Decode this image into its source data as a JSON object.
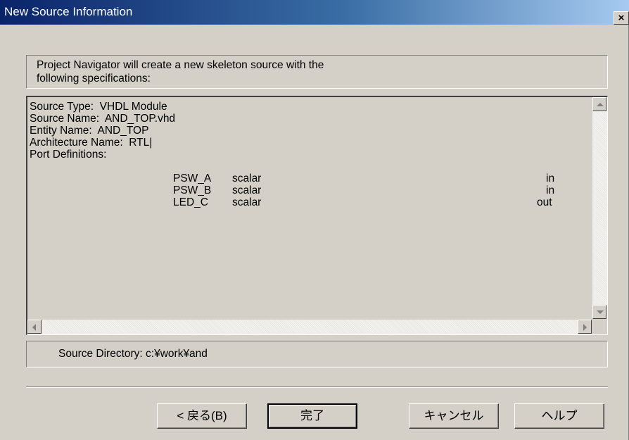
{
  "window": {
    "title": "New Source Information",
    "close_label": "×"
  },
  "header": {
    "line1": "Project Navigator will create a new skeleton source with the",
    "line2": "following specifications:"
  },
  "spec": {
    "source_type": "Source Type:  VHDL Module",
    "source_name": "Source Name:  AND_TOP.vhd",
    "entity_name": "Entity Name:  AND_TOP",
    "architecture_name": "Architecture Name:  RTL|",
    "port_definitions": "Port Definitions:",
    "ports": [
      {
        "name": "PSW_A",
        "type": "scalar",
        "dir": "in"
      },
      {
        "name": "PSW_B",
        "type": "scalar",
        "dir": "in"
      },
      {
        "name": "LED_C",
        "type": "scalar",
        "dir": "out"
      }
    ]
  },
  "source_directory": "Source Directory:  c:¥work¥and",
  "buttons": {
    "back": "< 戻る(B)",
    "finish": "完了",
    "cancel": "キャンセル",
    "help": "ヘルプ"
  }
}
